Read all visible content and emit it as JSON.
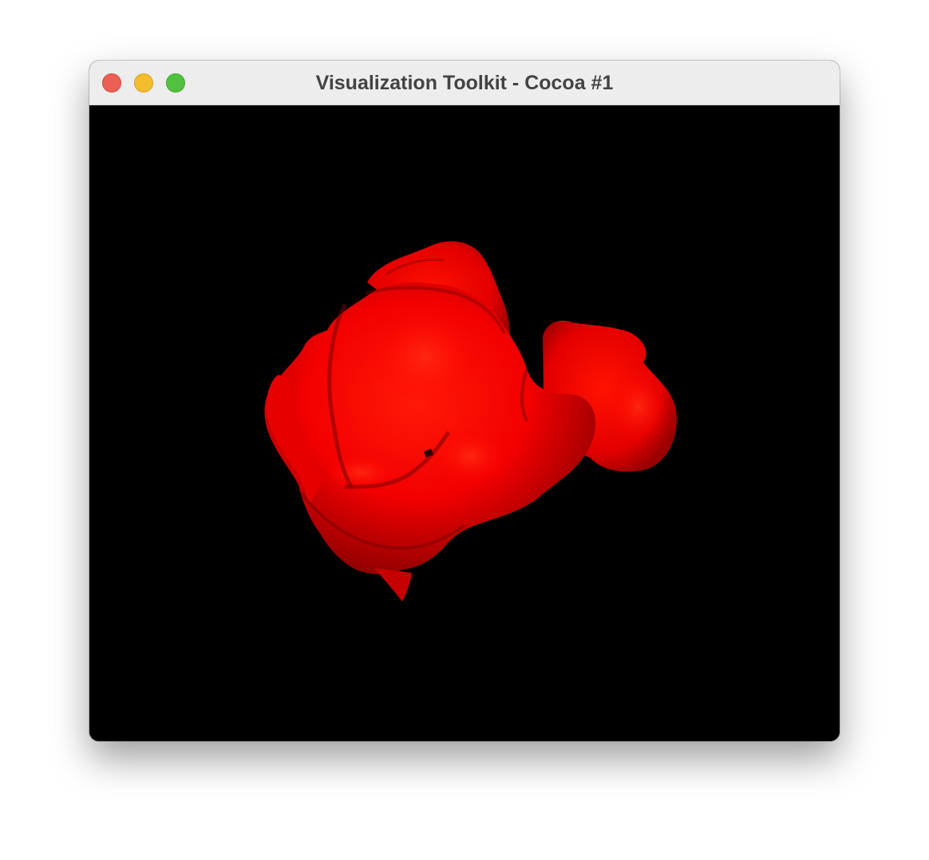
{
  "window": {
    "title": "Visualization Toolkit - Cocoa #1"
  },
  "render_view": {
    "background_color": "#000000",
    "object_color": "#ff0000",
    "object": "red-isosurface-blob"
  }
}
